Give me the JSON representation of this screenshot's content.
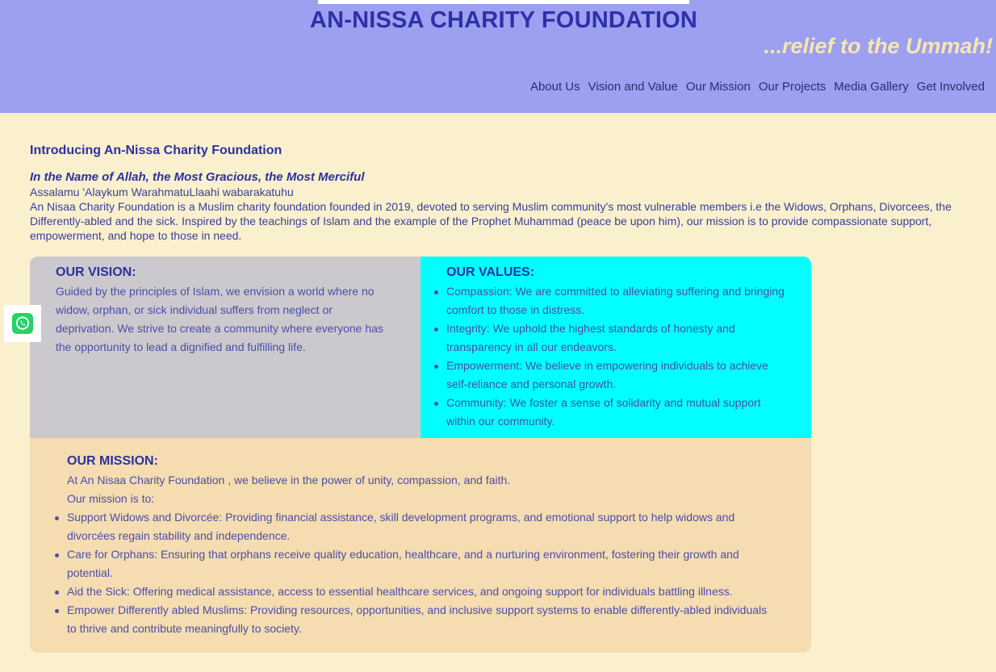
{
  "header": {
    "title": "AN-NISSA CHARITY FOUNDATION",
    "tagline": "...relief to the Ummah!",
    "nav": [
      "About Us",
      "Vision and Value",
      "Our Mission",
      "Our Projects",
      "Media Gallery",
      "Get Involved"
    ]
  },
  "intro": {
    "title": "Introducing An-Nissa Charity Foundation",
    "bismillah": "In the Name of Allah, the Most Gracious, the Most Merciful",
    "greeting": "Assalamu 'Alaykum WarahmatuLlaahi wabarakatuhu",
    "description": "An Nisaa Charity Foundation is a Muslim charity foundation founded in 2019, devoted to serving Muslim community's most vulnerable members i.e the Widows, Orphans, Divorcees, the Differently-abled and the sick. Inspired by the teachings of Islam and the example of the Prophet Muhammad (peace be upon him), our mission is to provide compassionate support, empowerment, and hope to those in need."
  },
  "vision": {
    "title": "OUR VISION:",
    "text": "Guided by the principles of Islam, we envision a world where no widow, orphan, or sick individual suffers from neglect or deprivation. We strive to create a community where everyone has the opportunity to lead a dignified and fulfilling life."
  },
  "values": {
    "title": "OUR VALUES:",
    "items": [
      "Compassion: We are committed to alleviating suffering and bringing comfort to those in distress.",
      "Integrity: We uphold the highest standards of honesty and transparency in all our endeavors.",
      "Empowerment: We believe in empowering individuals to achieve self-reliance and personal growth.",
      "Community: We foster a sense of solidarity and mutual support within our community."
    ]
  },
  "mission": {
    "title": "OUR MISSION:",
    "intro": "At An Nisaa Charity Foundation , we believe in the power of unity, compassion, and faith.",
    "lead": "Our mission is to:",
    "items": [
      "Support Widows and Divorcée: Providing financial assistance, skill development programs, and emotional support to help widows and divorcées regain stability and independence.",
      "Care for Orphans: Ensuring that orphans receive quality education, healthcare, and a nurturing environment, fostering their growth and potential.",
      "Aid the Sick: Offering medical assistance, access to essential healthcare services, and ongoing support for individuals battling illness.",
      "Empower Differently abled Muslims: Providing resources, opportunities, and inclusive support systems to enable differently-abled individuals to thrive and contribute meaningfully to society."
    ]
  },
  "floating": {
    "icon": "whatsapp-icon"
  },
  "colors": {
    "header_bg": "#9d9ff0",
    "page_bg": "#faf0cd",
    "title": "#2c31a8",
    "tagline": "#f6e7ae",
    "vision_bg": "#cbc9cd",
    "values_bg": "#00ffff",
    "mission_bg": "#f5dcb1",
    "whatsapp": "#25d366"
  }
}
